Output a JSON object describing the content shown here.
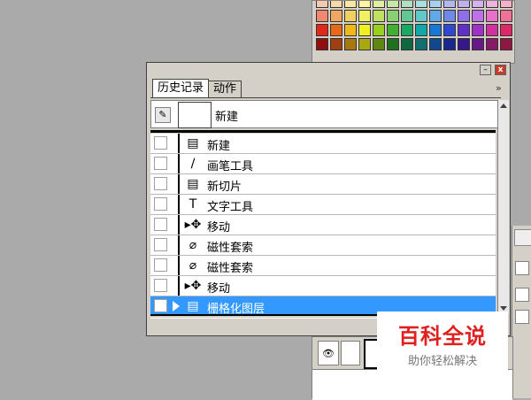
{
  "swatches": {
    "rows": [
      [
        "#f7c8b0",
        "#f8d8a8",
        "#f8e8a0",
        "#f8f4a0",
        "#e0f0a0",
        "#c8e8a8",
        "#b0e0c0",
        "#a8e0e0",
        "#a8d0f0",
        "#b0b8f0",
        "#c0b0f0",
        "#d8b0f0",
        "#f0b0e0",
        "#f8b0c8",
        "#f8b8b8",
        "#f0c0a8"
      ],
      [
        "#f08870",
        "#f0a860",
        "#f0d060",
        "#f0f060",
        "#c0e060",
        "#88d070",
        "#60c890",
        "#60c8c8",
        "#60a8e8",
        "#7088e8",
        "#9070e8",
        "#c070e8",
        "#e870c8",
        "#f07098",
        "#f07878",
        "#e89070"
      ],
      [
        "#e02818",
        "#e86818",
        "#f0b818",
        "#f0f020",
        "#98d020",
        "#40b030",
        "#18a860",
        "#10a8a8",
        "#1878d8",
        "#3048d0",
        "#6030c8",
        "#a030c8",
        "#d030a0",
        "#e02868",
        "#e03030",
        "#c85020"
      ],
      [
        "#901010",
        "#a04010",
        "#a87810",
        "#a8a810",
        "#608810",
        "#207020",
        "#106840",
        "#107070",
        "#104890",
        "#182890",
        "#381888",
        "#681888",
        "#881868",
        "#901840",
        "#901818",
        "#803010"
      ]
    ]
  },
  "history_panel": {
    "tabs": [
      {
        "label": "历史记录",
        "active": true
      },
      {
        "label": "动作",
        "active": false
      }
    ],
    "expand_label": "»",
    "snapshot": {
      "label": "新建"
    },
    "steps": [
      {
        "label": "新建",
        "icon": "▤"
      },
      {
        "label": "画笔工具",
        "icon": "∕"
      },
      {
        "label": "新切片",
        "icon": "▤"
      },
      {
        "label": "文字工具",
        "icon": "T"
      },
      {
        "label": "移动",
        "icon": "▸✥"
      },
      {
        "label": "磁性套索",
        "icon": "⌀"
      },
      {
        "label": "磁性套索",
        "icon": "⌀"
      },
      {
        "label": "移动",
        "icon": "▸✥"
      },
      {
        "label": "栅格化图层",
        "icon": "▤",
        "selected": true
      }
    ],
    "close_glyph": "x",
    "min_glyph": "–",
    "selection_color": "#3399ff"
  },
  "layers_panel": {
    "eye_glyph": "👁"
  },
  "watermark": {
    "main": "百科全说",
    "sub": "助你轻松解决"
  }
}
